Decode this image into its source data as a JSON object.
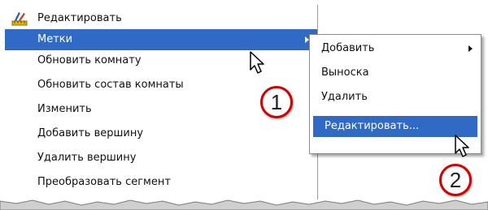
{
  "main_menu": {
    "items": [
      {
        "label": "Редактировать",
        "icon": "edit-layout-icon"
      },
      {
        "label": "Метки",
        "selected": true,
        "submenu_arrow": true
      },
      {
        "label": "Обновить комнату"
      },
      {
        "label": "Обновить состав комнаты"
      },
      {
        "label": "Изменить"
      },
      {
        "label": "Добавить вершину"
      },
      {
        "label": "Удалить вершину"
      },
      {
        "label": "Преобразовать сегмент"
      }
    ]
  },
  "sub_menu": {
    "items": [
      {
        "label": "Добавить",
        "submenu_arrow": true
      },
      {
        "label": "Выноска"
      },
      {
        "label": "Удалить"
      },
      {
        "label": "Редактировать...",
        "selected": true
      }
    ]
  },
  "callouts": [
    {
      "label": "1"
    },
    {
      "label": "2"
    }
  ],
  "colors": {
    "selection": "#316ac5",
    "callout_ring": "#d40000"
  }
}
